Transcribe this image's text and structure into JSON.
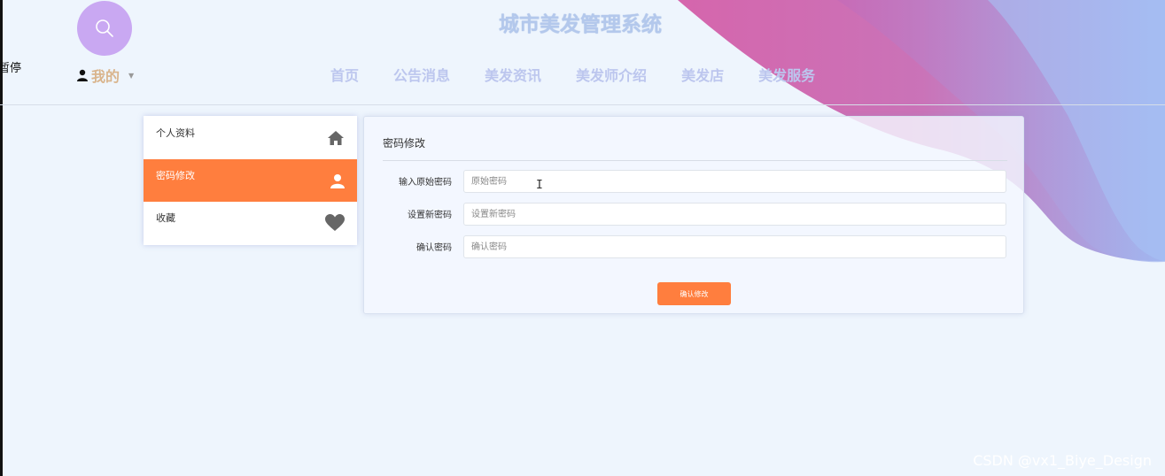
{
  "header": {
    "title": "城市美发管理系统",
    "edge_text": "暂停",
    "user_menu_label": "我的",
    "nav": [
      "首页",
      "公告消息",
      "美发资讯",
      "美发师介绍",
      "美发店",
      "美发服务"
    ]
  },
  "sidebar": {
    "items": [
      {
        "label": "个人资料",
        "icon": "home-icon"
      },
      {
        "label": "密码修改",
        "icon": "user-icon",
        "active": true
      },
      {
        "label": "收藏",
        "icon": "heart-icon"
      }
    ]
  },
  "form": {
    "title": "密码修改",
    "fields": [
      {
        "label": "输入原始密码",
        "placeholder": "原始密码",
        "value": ""
      },
      {
        "label": "设置新密码",
        "placeholder": "设置新密码",
        "value": ""
      },
      {
        "label": "确认密码",
        "placeholder": "确认密码",
        "value": ""
      }
    ],
    "submit_label": "确认修改"
  },
  "watermark": "CSDN @vx1_Biye_Design",
  "colors": {
    "accent": "#ff7e3e",
    "title": "#b3c8ec",
    "nav": "#bcc6ee",
    "search_circle": "#c9a8f2",
    "background": "#eef5fd"
  }
}
